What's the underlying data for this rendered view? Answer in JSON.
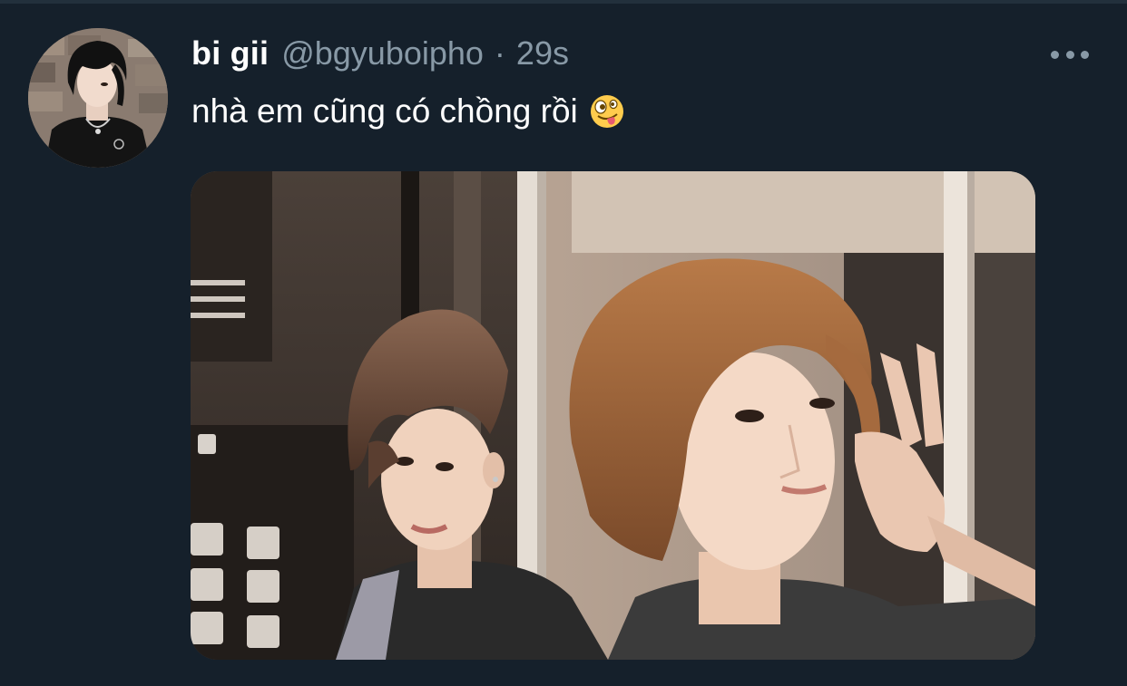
{
  "tweet": {
    "display_name": "bi gii",
    "handle": "@bgyuboipho",
    "separator": "·",
    "timestamp": "29s",
    "text": "nhà em cũng có chồng rồi",
    "emoji": "zany-face-emoji",
    "more_icon": "more-horizontal-icon",
    "avatar": "profile-avatar",
    "media": "attached-photo"
  },
  "colors": {
    "background": "#15202b",
    "primary_text": "#ffffff",
    "secondary_text": "#8899a6",
    "divider": "#22303c"
  }
}
